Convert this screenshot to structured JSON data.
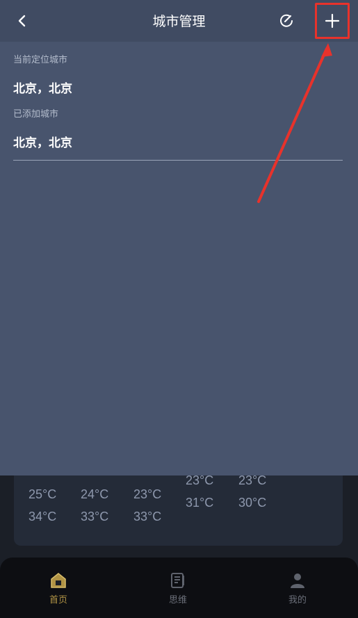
{
  "header": {
    "title": "城市管理"
  },
  "sections": {
    "current_label": "当前定位城市",
    "current_city": "北京，北京",
    "added_label": "已添加城市",
    "added_city": "北京，北京"
  },
  "forecast": {
    "columns": [
      {
        "low": "25°C",
        "high": "34°C"
      },
      {
        "low": "24°C",
        "high": "33°C"
      },
      {
        "low": "23°C",
        "high": "33°C"
      },
      {
        "low": "23°C",
        "high": "31°C"
      },
      {
        "low": "23°C",
        "high": "30°C"
      }
    ]
  },
  "tabbar": {
    "items": [
      {
        "label": "首页",
        "icon": "home-icon",
        "active": true
      },
      {
        "label": "思维",
        "icon": "notebook-icon",
        "active": false
      },
      {
        "label": "我的",
        "icon": "profile-icon",
        "active": false
      }
    ]
  },
  "colors": {
    "sheet_bg": "#48546d",
    "header_bg": "#404b62",
    "highlight": "#e8322b",
    "tab_active": "#b09345"
  }
}
